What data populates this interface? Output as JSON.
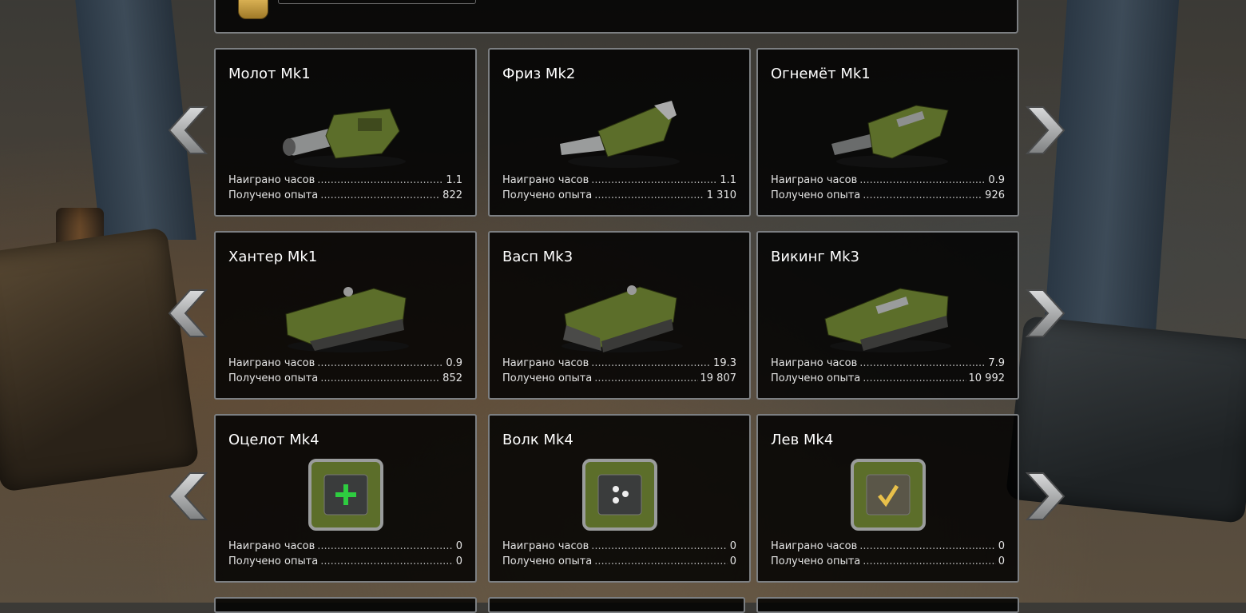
{
  "cards": [
    {
      "title": "Молот Mk1",
      "kind": "turret-hammer",
      "stats": [
        {
          "label": "Наиграно часов",
          "value": "1.1"
        },
        {
          "label": "Получено опыта",
          "value": "822"
        }
      ]
    },
    {
      "title": "Фриз Mk2",
      "kind": "turret-freeze",
      "stats": [
        {
          "label": "Наиграно часов",
          "value": "1.1"
        },
        {
          "label": "Получено опыта",
          "value": "1 310"
        }
      ]
    },
    {
      "title": "Огнемёт Mk1",
      "kind": "turret-firebird",
      "stats": [
        {
          "label": "Наиграно часов",
          "value": "0.9"
        },
        {
          "label": "Получено опыта",
          "value": "926"
        }
      ]
    },
    {
      "title": "Хантер Mk1",
      "kind": "hull-hunter",
      "stats": [
        {
          "label": "Наиграно часов",
          "value": "0.9"
        },
        {
          "label": "Получено опыта",
          "value": "852"
        }
      ]
    },
    {
      "title": "Васп Mk3",
      "kind": "hull-wasp",
      "stats": [
        {
          "label": "Наиграно часов",
          "value": "19.3"
        },
        {
          "label": "Получено опыта",
          "value": "19 807"
        }
      ]
    },
    {
      "title": "Викинг Mk3",
      "kind": "hull-viking",
      "stats": [
        {
          "label": "Наиграно часов",
          "value": "7.9"
        },
        {
          "label": "Получено опыта",
          "value": "10 992"
        }
      ]
    },
    {
      "title": "Оцелот Mk4",
      "kind": "module-plus",
      "stats": [
        {
          "label": "Наиграно часов",
          "value": "0"
        },
        {
          "label": "Получено опыта",
          "value": "0"
        }
      ]
    },
    {
      "title": "Волк Mk4",
      "kind": "module-dots",
      "stats": [
        {
          "label": "Наиграно часов",
          "value": "0"
        },
        {
          "label": "Получено опыта",
          "value": "0"
        }
      ]
    },
    {
      "title": "Лев Mk4",
      "kind": "module-check",
      "stats": [
        {
          "label": "Наиграно часов",
          "value": "0"
        },
        {
          "label": "Получено опыта",
          "value": "0"
        }
      ]
    }
  ],
  "colors": {
    "card_bg": "#000000",
    "card_border": "#7c7f82",
    "item_green": "#5c6e2a",
    "module_plus": "#2ecc40",
    "module_check": "#e8c04a"
  }
}
